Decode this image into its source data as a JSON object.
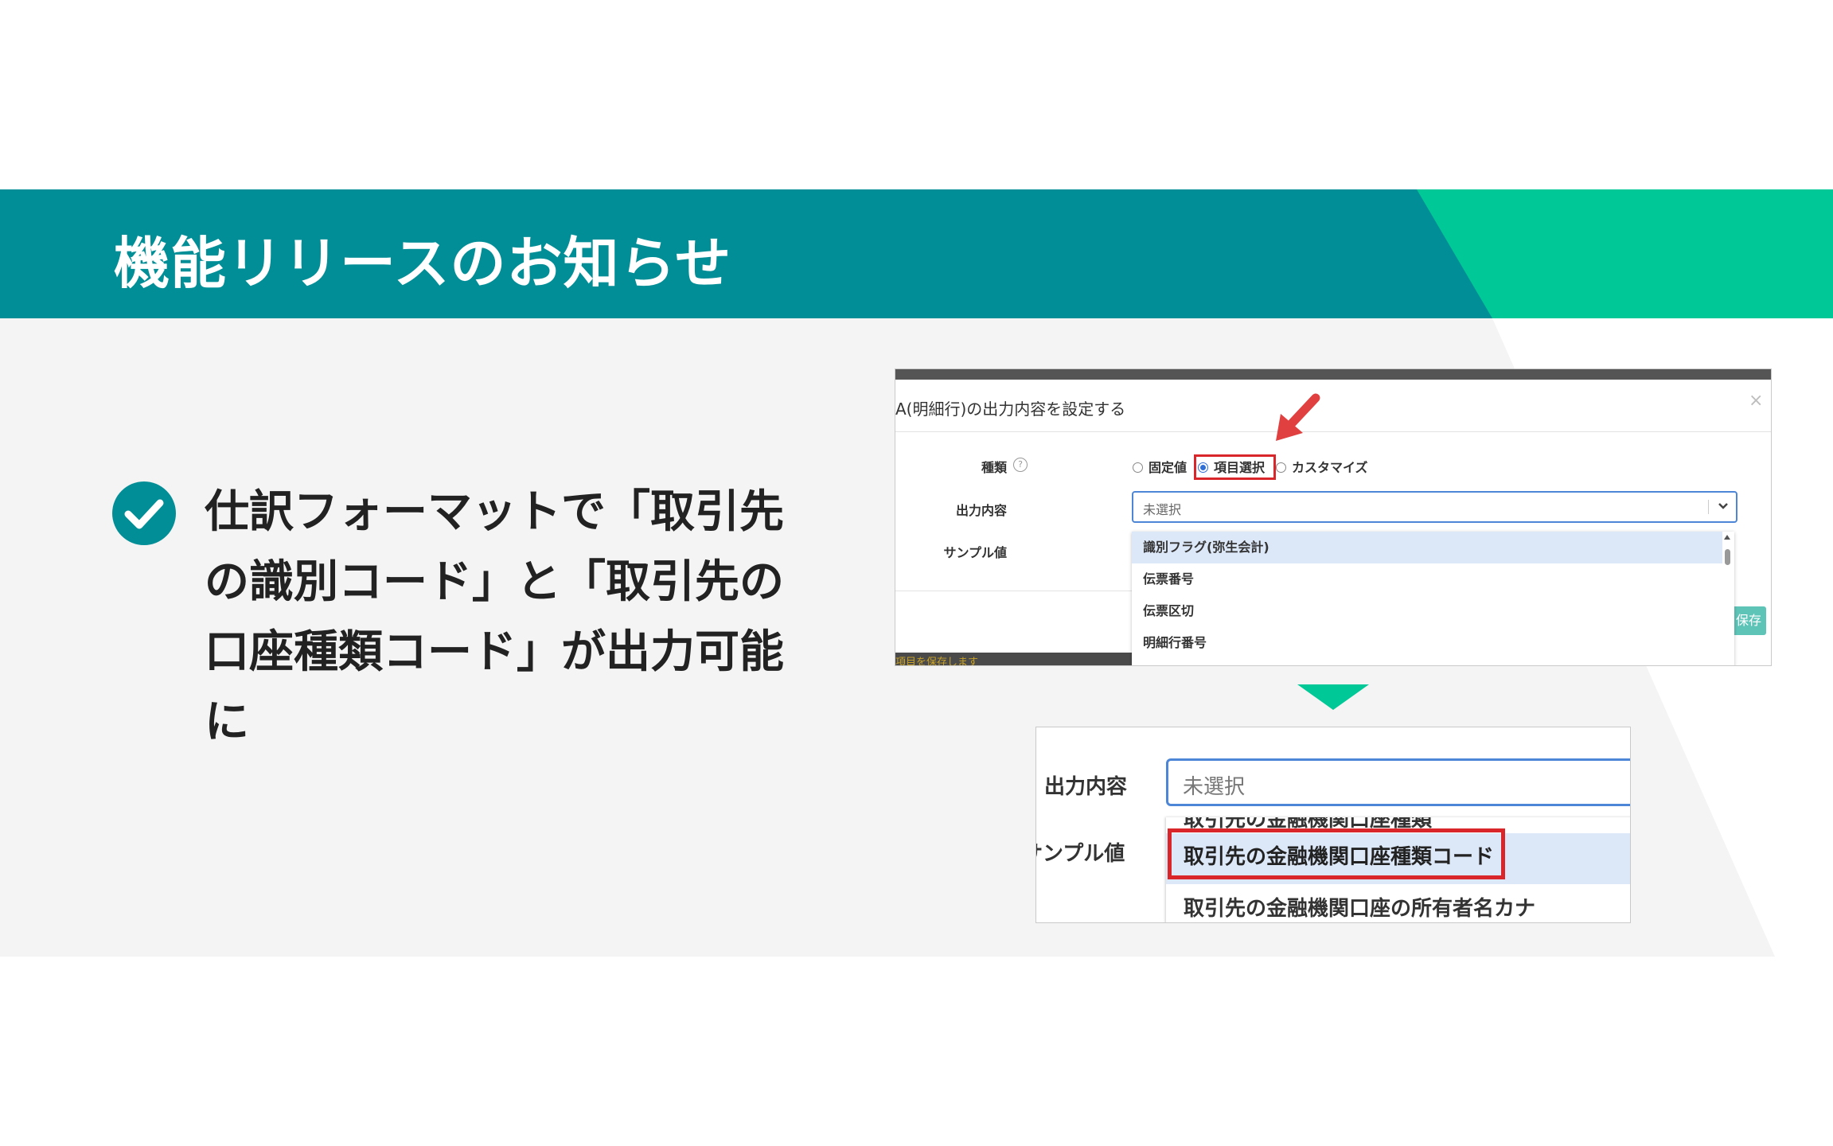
{
  "header": {
    "title": "機能リリースのお知らせ"
  },
  "bullet": {
    "text": "仕訳フォーマットで「取引先の識別コード」と「取引先の口座種類コード」が出力可能に"
  },
  "modal": {
    "title": "A(明細行)の出力内容を設定する",
    "close": "×",
    "kind_label": "種類",
    "help": "?",
    "radios": [
      {
        "label": "固定値",
        "checked": false
      },
      {
        "label": "項目選択",
        "checked": true
      },
      {
        "label": "カスタマイズ",
        "checked": false
      }
    ],
    "output_label": "出力内容",
    "sample_label": "サンプル値",
    "select_value": "未選択",
    "options": [
      "識別フラグ(弥生会計)",
      "伝票番号",
      "伝票区切",
      "明細行番号"
    ],
    "save_button": "保存",
    "bottom_text": "項目を保存します"
  },
  "zoom": {
    "output_label": "出力内容",
    "sample_label": "サンプル値",
    "select_value": "未選択",
    "options": [
      "取引先の金融機関口座種類",
      "取引先の金融機関口座種類コード",
      "取引先の金融機関口座の所有者名カナ"
    ]
  },
  "colors": {
    "teal": "#028e96",
    "accent_green": "#00c896",
    "highlight_red": "#d8262a",
    "select_blue": "#4d86d6"
  }
}
